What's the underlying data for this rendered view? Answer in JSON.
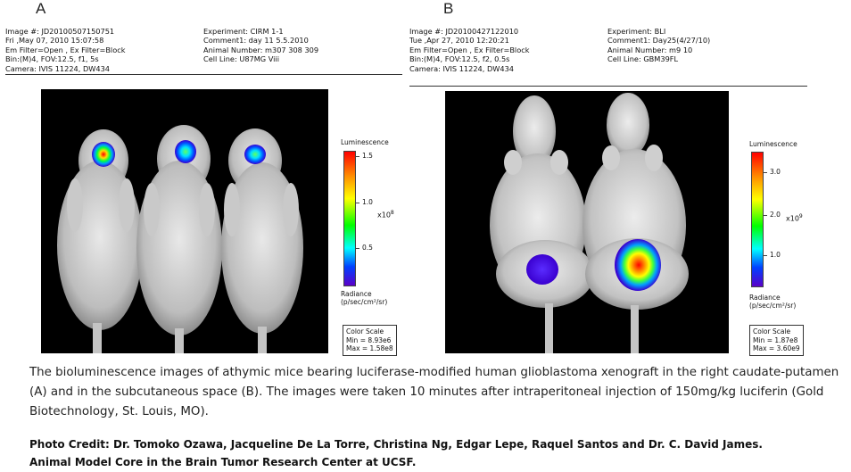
{
  "panel_a": {
    "letter": "A",
    "meta_left": [
      "Image #: JD20100507150751",
      "Fri ,May 07, 2010 15:07:58",
      "Em Filter=Open , Ex Filter=Block",
      "Bin:(M)4, FOV:12.5, f1, 5s",
      "Camera: IVIS 11224, DW434"
    ],
    "meta_right": [
      "Experiment: CIRM 1-1",
      "Comment1: day 11 5.5.2010",
      "Animal Number: m307 308 309",
      "Cell Line: U87MG Viii"
    ],
    "colorbar": {
      "title": "Luminescence",
      "ticks": [
        "1.5",
        "1.0",
        "0.5"
      ],
      "exp_base": "x10",
      "exp_power": "8",
      "unit_line1": "Radiance",
      "unit_line2": "(p/sec/cm²/sr)"
    },
    "scale": [
      "Color Scale",
      "Min = 8.93e6",
      "Max = 1.58e8"
    ]
  },
  "panel_b": {
    "letter": "B",
    "meta_left": [
      "Image #: JD20100427122010",
      "Tue ,Apr 27, 2010 12:20:21",
      "Em Filter=Open , Ex Filter=Block",
      "Bin:(M)4, FOV:12.5, f2, 0.5s",
      "Camera: IVIS 11224, DW434"
    ],
    "meta_right": [
      "Experiment: BLI",
      "Comment1: Day25(4/27/10)",
      "Animal Number: m9 10",
      "Cell Line: GBM39FL"
    ],
    "colorbar": {
      "title": "Luminescence",
      "ticks": [
        "3.0",
        "2.0",
        "1.0"
      ],
      "exp_base": "x10",
      "exp_power": "9",
      "unit_line1": "Radiance",
      "unit_line2": "(p/sec/cm²/sr)"
    },
    "scale": [
      "Color Scale",
      "Min = 1.87e8",
      "Max = 3.60e9"
    ]
  },
  "caption": "The  bioluminescence  images of athymic mice bearing luciferase-modified  human glioblastoma xenograft  in the right caudate-putamen  (A) and in the subcutaneous space (B).  The images were taken 10 minutes after intraperitoneal injection  of 150mg/kg luciferin (Gold Biotechnology, St. Louis, MO).",
  "credit_line1": "Photo Credit: Dr. Tomoko Ozawa, Jacqueline De La Torre, Christina Ng, Edgar Lepe, Raquel Santos and Dr. C. David James.",
  "credit_line2": "Animal Model Core in the Brain Tumor Research Center at UCSF."
}
